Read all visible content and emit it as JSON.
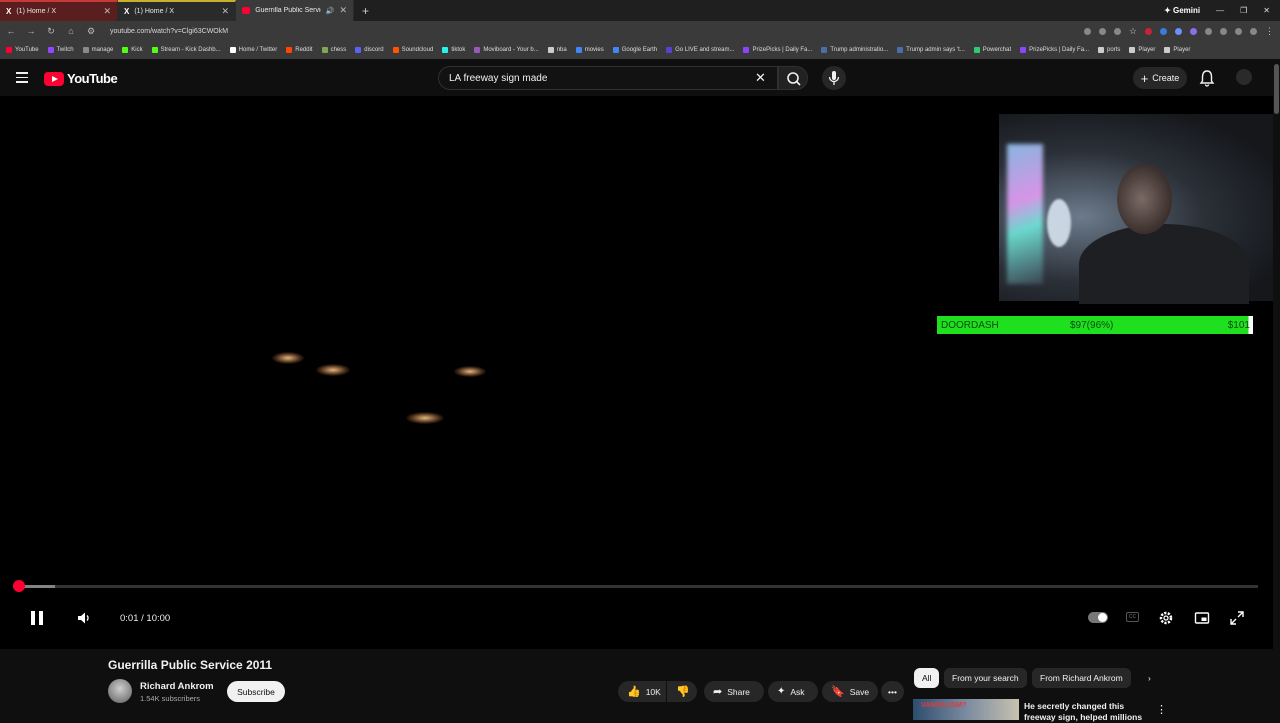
{
  "browser": {
    "tabs": [
      {
        "title": "(1) Home / X",
        "style": "red"
      },
      {
        "title": "(1) Home / X",
        "style": "yellow"
      },
      {
        "title": "Guerrilla Public Service 201",
        "style": "active"
      }
    ],
    "gemini_label": "Gemini",
    "url": "youtube.com/watch?v=Clgi63CWOkM",
    "bookmarks": [
      "YouTube",
      "Twitch",
      "manage",
      "Kick",
      "Stream - Kick Dashb...",
      "Home / Twitter",
      "Reddit",
      "chess",
      "discord",
      "Soundcloud",
      "tiktok",
      "Moviboard - Your b...",
      "nba",
      "movies",
      "Google Earth",
      "Go LIVE and stream...",
      "PrizePicks | Daily Fa...",
      "Trump administratio...",
      "Trump admin says 't...",
      "Powerchat",
      "PrizePicks | Daily Fa...",
      "ports",
      "Player",
      "Player"
    ]
  },
  "youtube": {
    "logo_text": "YouTube",
    "search_value": "LA freeway sign made",
    "create_label": "Create"
  },
  "overlay": {
    "goal_label": "DOORDASH",
    "goal_progress": "$97(96%)",
    "goal_target": "$101",
    "goal_fraction": 0.96
  },
  "player": {
    "time_display": "0:01 / 10:00",
    "played_fraction": 0.001,
    "buffered_fraction": 0.03,
    "cc_label": "CC"
  },
  "video_info": {
    "title": "Guerrilla Public Service 2011",
    "channel": "Richard Ankrom",
    "subscribers": "1.54K subscribers",
    "subscribe_label": "Subscribe",
    "like_count": "10K",
    "share_label": "Share",
    "ask_label": "Ask",
    "save_label": "Save"
  },
  "chips": [
    "All",
    "From your search",
    "From Richard Ankrom"
  ],
  "recommended": {
    "thumb_text": "VANDALISM?",
    "title": "He secretly changed this freeway sign, helped millions"
  },
  "colors": {
    "accent_red": "#ff0033",
    "goal_green": "#1fe01f",
    "background": "#0f0f0f"
  }
}
